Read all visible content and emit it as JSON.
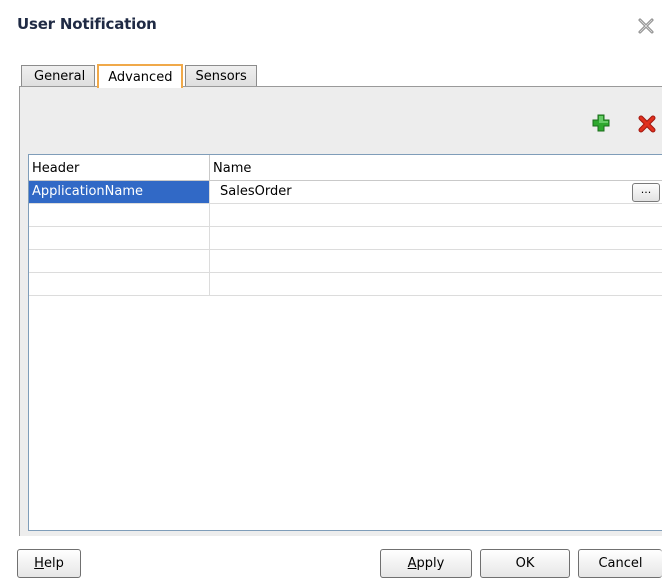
{
  "dialog": {
    "title": "User Notification"
  },
  "tabs": [
    {
      "label": "General",
      "active": false
    },
    {
      "label": "Advanced",
      "active": true
    },
    {
      "label": "Sensors",
      "active": false
    }
  ],
  "toolbar": {
    "add_icon": "add-icon",
    "remove_icon": "delete-icon",
    "add_color": "#2fa82f",
    "remove_color": "#e0301e"
  },
  "table": {
    "columns": [
      "Header",
      "Name"
    ],
    "rows": [
      {
        "header": "ApplicationName",
        "name": "SalesOrder",
        "selected": true,
        "browse_label": "..."
      },
      {
        "header": "",
        "name": ""
      },
      {
        "header": "",
        "name": ""
      },
      {
        "header": "",
        "name": ""
      },
      {
        "header": "",
        "name": ""
      }
    ]
  },
  "buttons": {
    "help": {
      "mnemonic": "H",
      "rest": "elp"
    },
    "apply": {
      "mnemonic": "A",
      "rest": "pply"
    },
    "ok": "OK",
    "cancel": "Cancel"
  },
  "colors": {
    "selection": "#3169c6",
    "active_tab_border": "#f0a94a",
    "title": "#1f2a44"
  }
}
